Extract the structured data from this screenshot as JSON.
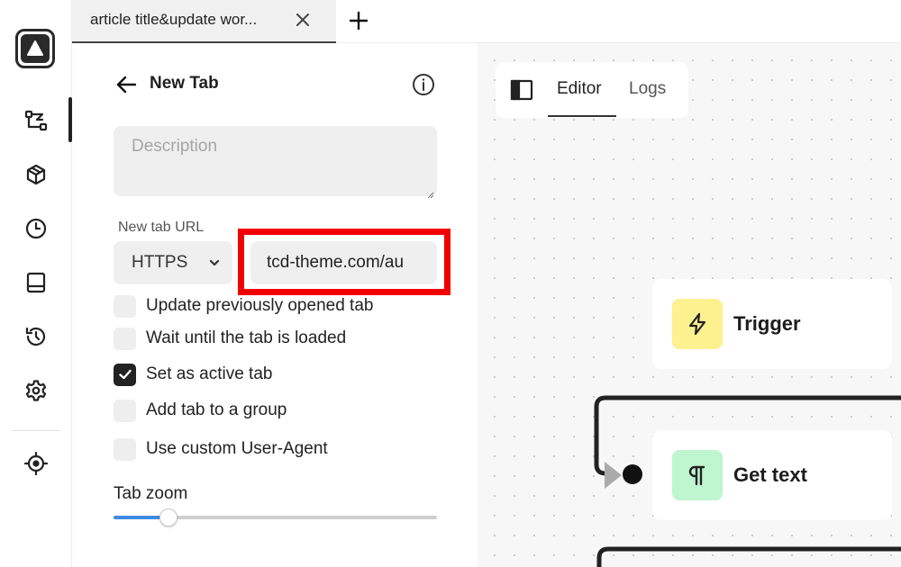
{
  "rail": {
    "items": [
      {
        "icon": "workflow-icon"
      },
      {
        "icon": "package-icon"
      },
      {
        "icon": "clock-icon"
      },
      {
        "icon": "storage-icon"
      },
      {
        "icon": "history-icon"
      },
      {
        "icon": "gear-icon"
      },
      {
        "icon": "crosshair-icon"
      }
    ]
  },
  "tabs": {
    "active_title": "article title&update wor...",
    "close_icon": "close-icon",
    "add_icon": "plus-icon"
  },
  "panel": {
    "title": "New Tab",
    "description_placeholder": "Description",
    "url_label": "New tab URL",
    "protocol": "HTTPS",
    "url_value": "tcd-theme.com/au",
    "checkboxes": [
      {
        "label": "Update previously opened tab",
        "checked": false
      },
      {
        "label": "Wait until the tab is loaded",
        "checked": false
      },
      {
        "label": "Set as active tab",
        "checked": true
      },
      {
        "label": "Add tab to a group",
        "checked": false
      },
      {
        "label": "Use custom User-Agent",
        "checked": false
      }
    ],
    "zoom_label": "Tab zoom",
    "zoom_fraction": 0.17
  },
  "canvas": {
    "view_tabs": {
      "editor": "Editor",
      "logs": "Logs",
      "active": "Editor"
    },
    "nodes": [
      {
        "label": "Trigger",
        "icon": "lightning-icon",
        "color": "#fdf08f"
      },
      {
        "label": "Get text",
        "icon": "paragraph-icon",
        "color": "#bff5cf"
      }
    ]
  },
  "colors": {
    "highlight": "#f20000",
    "slider_fill": "#3d8be0"
  }
}
